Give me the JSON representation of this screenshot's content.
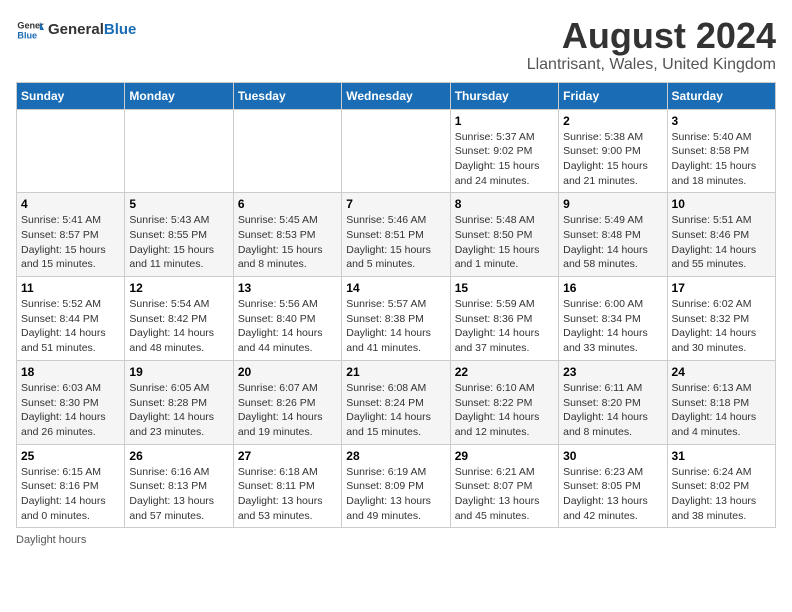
{
  "header": {
    "logo_general": "General",
    "logo_blue": "Blue",
    "title": "August 2024",
    "subtitle": "Llantrisant, Wales, United Kingdom"
  },
  "calendar": {
    "days_of_week": [
      "Sunday",
      "Monday",
      "Tuesday",
      "Wednesday",
      "Thursday",
      "Friday",
      "Saturday"
    ],
    "weeks": [
      [
        {
          "day": "",
          "sunrise": "",
          "sunset": "",
          "daylight": ""
        },
        {
          "day": "",
          "sunrise": "",
          "sunset": "",
          "daylight": ""
        },
        {
          "day": "",
          "sunrise": "",
          "sunset": "",
          "daylight": ""
        },
        {
          "day": "",
          "sunrise": "",
          "sunset": "",
          "daylight": ""
        },
        {
          "day": "1",
          "sunrise": "5:37 AM",
          "sunset": "9:02 PM",
          "daylight": "15 hours and 24 minutes."
        },
        {
          "day": "2",
          "sunrise": "5:38 AM",
          "sunset": "9:00 PM",
          "daylight": "15 hours and 21 minutes."
        },
        {
          "day": "3",
          "sunrise": "5:40 AM",
          "sunset": "8:58 PM",
          "daylight": "15 hours and 18 minutes."
        }
      ],
      [
        {
          "day": "4",
          "sunrise": "5:41 AM",
          "sunset": "8:57 PM",
          "daylight": "15 hours and 15 minutes."
        },
        {
          "day": "5",
          "sunrise": "5:43 AM",
          "sunset": "8:55 PM",
          "daylight": "15 hours and 11 minutes."
        },
        {
          "day": "6",
          "sunrise": "5:45 AM",
          "sunset": "8:53 PM",
          "daylight": "15 hours and 8 minutes."
        },
        {
          "day": "7",
          "sunrise": "5:46 AM",
          "sunset": "8:51 PM",
          "daylight": "15 hours and 5 minutes."
        },
        {
          "day": "8",
          "sunrise": "5:48 AM",
          "sunset": "8:50 PM",
          "daylight": "15 hours and 1 minute."
        },
        {
          "day": "9",
          "sunrise": "5:49 AM",
          "sunset": "8:48 PM",
          "daylight": "14 hours and 58 minutes."
        },
        {
          "day": "10",
          "sunrise": "5:51 AM",
          "sunset": "8:46 PM",
          "daylight": "14 hours and 55 minutes."
        }
      ],
      [
        {
          "day": "11",
          "sunrise": "5:52 AM",
          "sunset": "8:44 PM",
          "daylight": "14 hours and 51 minutes."
        },
        {
          "day": "12",
          "sunrise": "5:54 AM",
          "sunset": "8:42 PM",
          "daylight": "14 hours and 48 minutes."
        },
        {
          "day": "13",
          "sunrise": "5:56 AM",
          "sunset": "8:40 PM",
          "daylight": "14 hours and 44 minutes."
        },
        {
          "day": "14",
          "sunrise": "5:57 AM",
          "sunset": "8:38 PM",
          "daylight": "14 hours and 41 minutes."
        },
        {
          "day": "15",
          "sunrise": "5:59 AM",
          "sunset": "8:36 PM",
          "daylight": "14 hours and 37 minutes."
        },
        {
          "day": "16",
          "sunrise": "6:00 AM",
          "sunset": "8:34 PM",
          "daylight": "14 hours and 33 minutes."
        },
        {
          "day": "17",
          "sunrise": "6:02 AM",
          "sunset": "8:32 PM",
          "daylight": "14 hours and 30 minutes."
        }
      ],
      [
        {
          "day": "18",
          "sunrise": "6:03 AM",
          "sunset": "8:30 PM",
          "daylight": "14 hours and 26 minutes."
        },
        {
          "day": "19",
          "sunrise": "6:05 AM",
          "sunset": "8:28 PM",
          "daylight": "14 hours and 23 minutes."
        },
        {
          "day": "20",
          "sunrise": "6:07 AM",
          "sunset": "8:26 PM",
          "daylight": "14 hours and 19 minutes."
        },
        {
          "day": "21",
          "sunrise": "6:08 AM",
          "sunset": "8:24 PM",
          "daylight": "14 hours and 15 minutes."
        },
        {
          "day": "22",
          "sunrise": "6:10 AM",
          "sunset": "8:22 PM",
          "daylight": "14 hours and 12 minutes."
        },
        {
          "day": "23",
          "sunrise": "6:11 AM",
          "sunset": "8:20 PM",
          "daylight": "14 hours and 8 minutes."
        },
        {
          "day": "24",
          "sunrise": "6:13 AM",
          "sunset": "8:18 PM",
          "daylight": "14 hours and 4 minutes."
        }
      ],
      [
        {
          "day": "25",
          "sunrise": "6:15 AM",
          "sunset": "8:16 PM",
          "daylight": "14 hours and 0 minutes."
        },
        {
          "day": "26",
          "sunrise": "6:16 AM",
          "sunset": "8:13 PM",
          "daylight": "13 hours and 57 minutes."
        },
        {
          "day": "27",
          "sunrise": "6:18 AM",
          "sunset": "8:11 PM",
          "daylight": "13 hours and 53 minutes."
        },
        {
          "day": "28",
          "sunrise": "6:19 AM",
          "sunset": "8:09 PM",
          "daylight": "13 hours and 49 minutes."
        },
        {
          "day": "29",
          "sunrise": "6:21 AM",
          "sunset": "8:07 PM",
          "daylight": "13 hours and 45 minutes."
        },
        {
          "day": "30",
          "sunrise": "6:23 AM",
          "sunset": "8:05 PM",
          "daylight": "13 hours and 42 minutes."
        },
        {
          "day": "31",
          "sunrise": "6:24 AM",
          "sunset": "8:02 PM",
          "daylight": "13 hours and 38 minutes."
        }
      ]
    ]
  },
  "footer": {
    "note": "Daylight hours"
  }
}
